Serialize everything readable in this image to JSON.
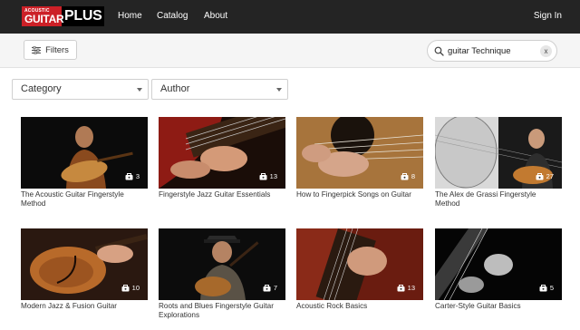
{
  "brand": {
    "small": "ACOUSTIC",
    "big": "GUITAR",
    "plus": "PLUS"
  },
  "nav": {
    "home": "Home",
    "catalog": "Catalog",
    "about": "About",
    "signin": "Sign In"
  },
  "toolbar": {
    "filters_label": "Filters"
  },
  "search": {
    "value": "guitar Technique",
    "clear_label": "x"
  },
  "filters": {
    "category_label": "Category",
    "author_label": "Author"
  },
  "courses": [
    {
      "title": "The Acoustic Guitar Fingerstyle Method",
      "count": "3"
    },
    {
      "title": "Fingerstyle Jazz Guitar Essentials",
      "count": "13"
    },
    {
      "title": "How to Fingerpick Songs on Guitar",
      "count": "8"
    },
    {
      "title": "The Alex de Grassi Fingerstyle Method",
      "count": "27"
    },
    {
      "title": "Modern Jazz & Fusion Guitar",
      "count": "10"
    },
    {
      "title": "Roots and Blues Fingerstyle Guitar Explorations",
      "count": "7"
    },
    {
      "title": "Acoustic Rock Basics",
      "count": "13"
    },
    {
      "title": "Carter-Style Guitar Basics",
      "count": "5"
    }
  ],
  "colors": {
    "nav_bg": "#242424",
    "brand_red": "#cc2027",
    "subbar_bg": "#f5f5f5"
  }
}
